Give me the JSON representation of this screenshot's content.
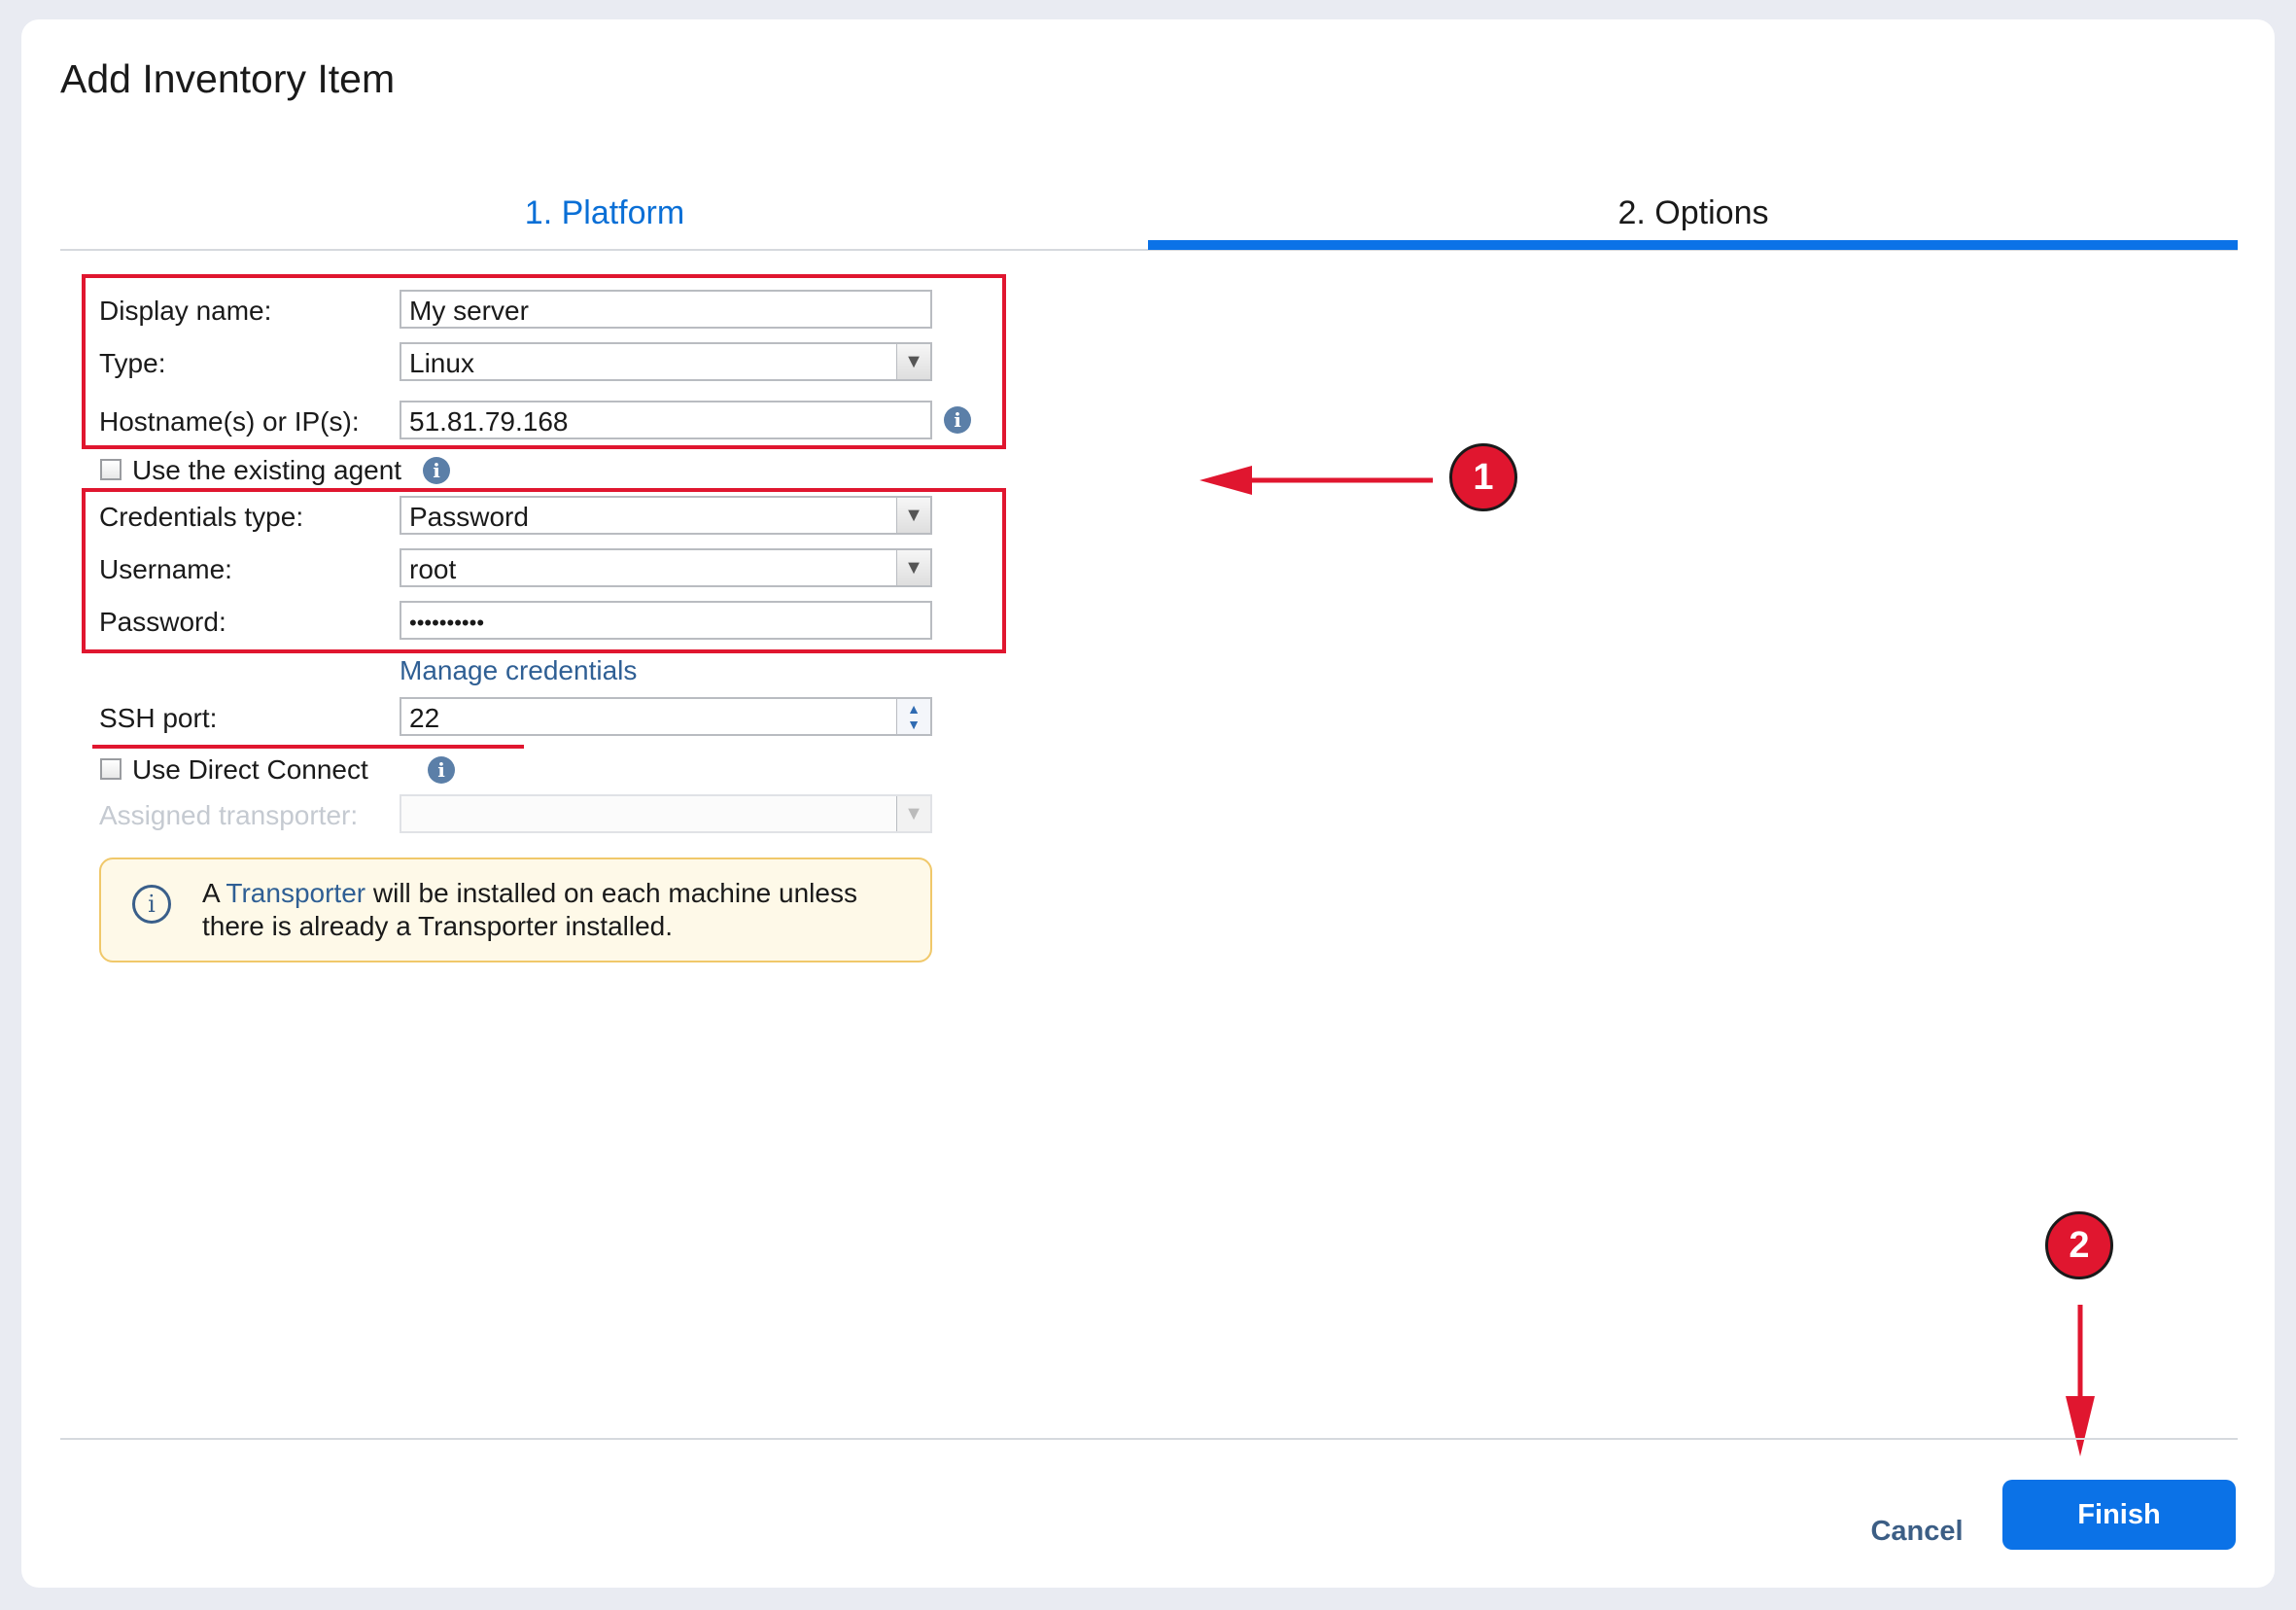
{
  "dialog": {
    "title": "Add Inventory Item"
  },
  "steps": [
    {
      "label": "1. Platform"
    },
    {
      "label": "2. Options"
    }
  ],
  "form": {
    "display_name": {
      "label": "Display name:",
      "value": "My server"
    },
    "type": {
      "label": "Type:",
      "value": "Linux"
    },
    "hostname": {
      "label": "Hostname(s) or IP(s):",
      "value": "51.81.79.168"
    },
    "use_existing_agent": {
      "label": "Use the existing agent",
      "checked": false
    },
    "credentials_type": {
      "label": "Credentials type:",
      "value": "Password"
    },
    "username": {
      "label": "Username:",
      "value": "root"
    },
    "password": {
      "label": "Password:",
      "value": "••••••••••"
    },
    "manage_credentials": "Manage credentials",
    "ssh_port": {
      "label": "SSH port:",
      "value": "22"
    },
    "use_direct_connect": {
      "label": "Use Direct Connect",
      "checked": false
    },
    "assigned_transporter": {
      "label": "Assigned transporter:",
      "value": ""
    }
  },
  "notice": {
    "prefix": "A",
    "link": "Transporter",
    "suffix": "will be installed on each machine unless there is already a Transporter installed."
  },
  "footer": {
    "cancel": "Cancel",
    "finish": "Finish"
  },
  "annotations": {
    "badge1": "1",
    "badge2": "2",
    "color": "#e0162f"
  },
  "colors": {
    "accent": "#0b72e7",
    "link": "#2f5f94"
  }
}
